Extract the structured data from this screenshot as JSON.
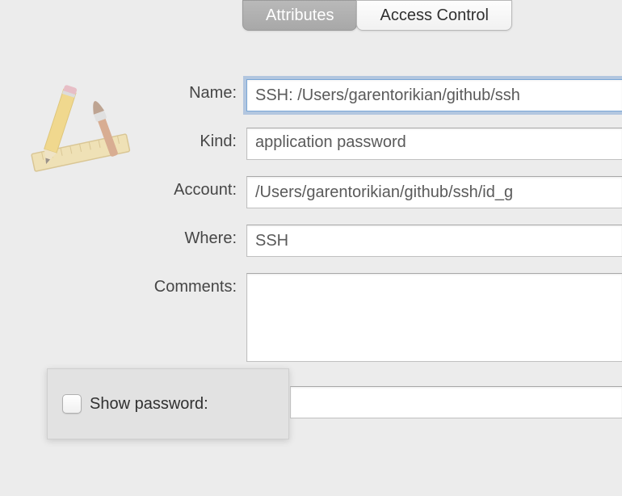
{
  "tabs": {
    "attributes": "Attributes",
    "access_control": "Access Control"
  },
  "icon": "application-tools-icon",
  "labels": {
    "name": "Name:",
    "kind": "Kind:",
    "account": "Account:",
    "where": "Where:",
    "comments": "Comments:",
    "show_password": "Show password:"
  },
  "values": {
    "name": "SSH: /Users/garentorikian/github/ssh",
    "kind": "application password",
    "account": "/Users/garentorikian/github/ssh/id_g",
    "where": "SSH",
    "comments": "",
    "password": ""
  }
}
